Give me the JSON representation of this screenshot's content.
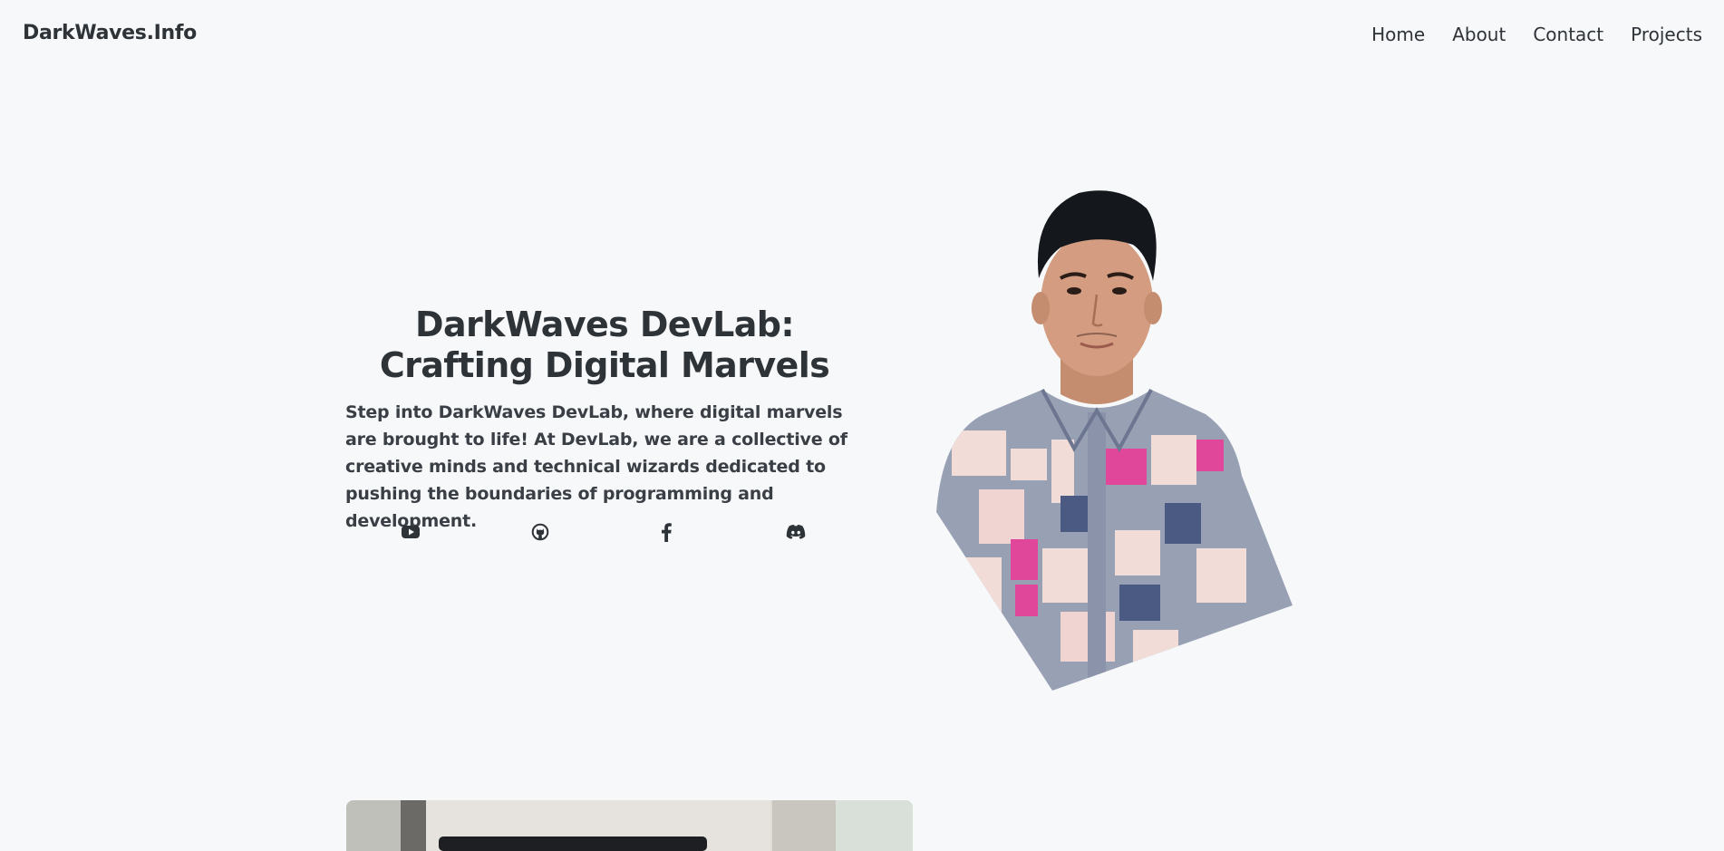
{
  "nav": {
    "brand": "DarkWaves.Info",
    "links": [
      "Home",
      "About",
      "Contact",
      "Projects"
    ]
  },
  "hero": {
    "title": "DarkWaves DevLab: Crafting Digital Marvels",
    "description": "Step into DarkWaves DevLab, where digital marvels are brought to life! At DevLab, we are a collective of creative minds and technical wizards dedicated to pushing the boundaries of programming and development.",
    "socials": [
      {
        "icon": "youtube-icon"
      },
      {
        "icon": "github-icon"
      },
      {
        "icon": "facebook-icon"
      },
      {
        "icon": "discord-icon"
      }
    ]
  },
  "colors": {
    "background": "#f7f8fa",
    "text": "#2e3338",
    "shirt_accent": "#e0469a",
    "shirt_base": "#98a0b4"
  }
}
